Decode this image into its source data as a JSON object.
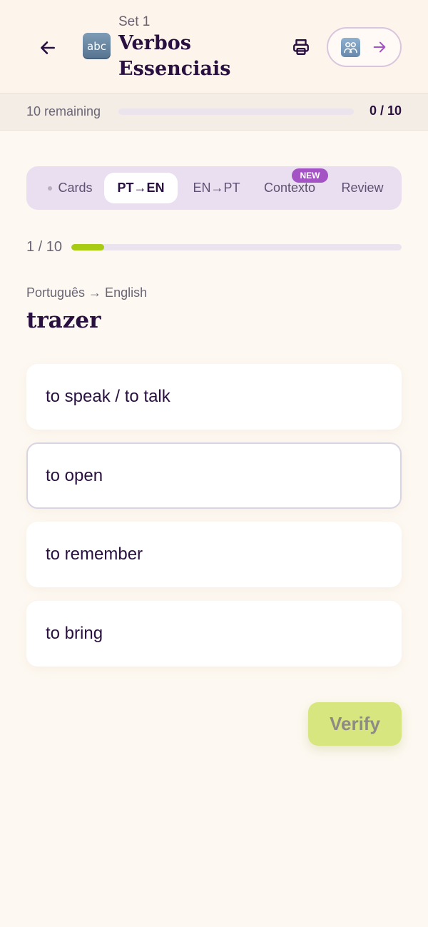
{
  "header": {
    "set_label": "Set 1",
    "set_title": "Verbos Essenciais",
    "set_emoji": "abc"
  },
  "remaining": {
    "label": "10 remaining",
    "count": "0 / 10",
    "fraction": 0
  },
  "tabs": [
    {
      "label": "Cards",
      "active": false
    },
    {
      "label": "PT→EN",
      "active": true
    },
    {
      "label": "EN→PT",
      "active": false
    },
    {
      "label": "Contexto",
      "active": false,
      "badge": "NEW"
    },
    {
      "label": "Review",
      "active": false
    }
  ],
  "progress": {
    "label": "1 / 10",
    "fraction": 0.1
  },
  "question": {
    "direction": "Português → English",
    "word": "trazer"
  },
  "options": [
    {
      "label": "to speak / to talk",
      "selected": false
    },
    {
      "label": "to open",
      "selected": true
    },
    {
      "label": "to remember",
      "selected": false
    },
    {
      "label": "to bring",
      "selected": false
    }
  ],
  "verify_label": "Verify",
  "colors": {
    "accent": "#a453c4",
    "progress": "#a8cc14",
    "verify": "#d7e67e",
    "text": "#2a1040"
  }
}
